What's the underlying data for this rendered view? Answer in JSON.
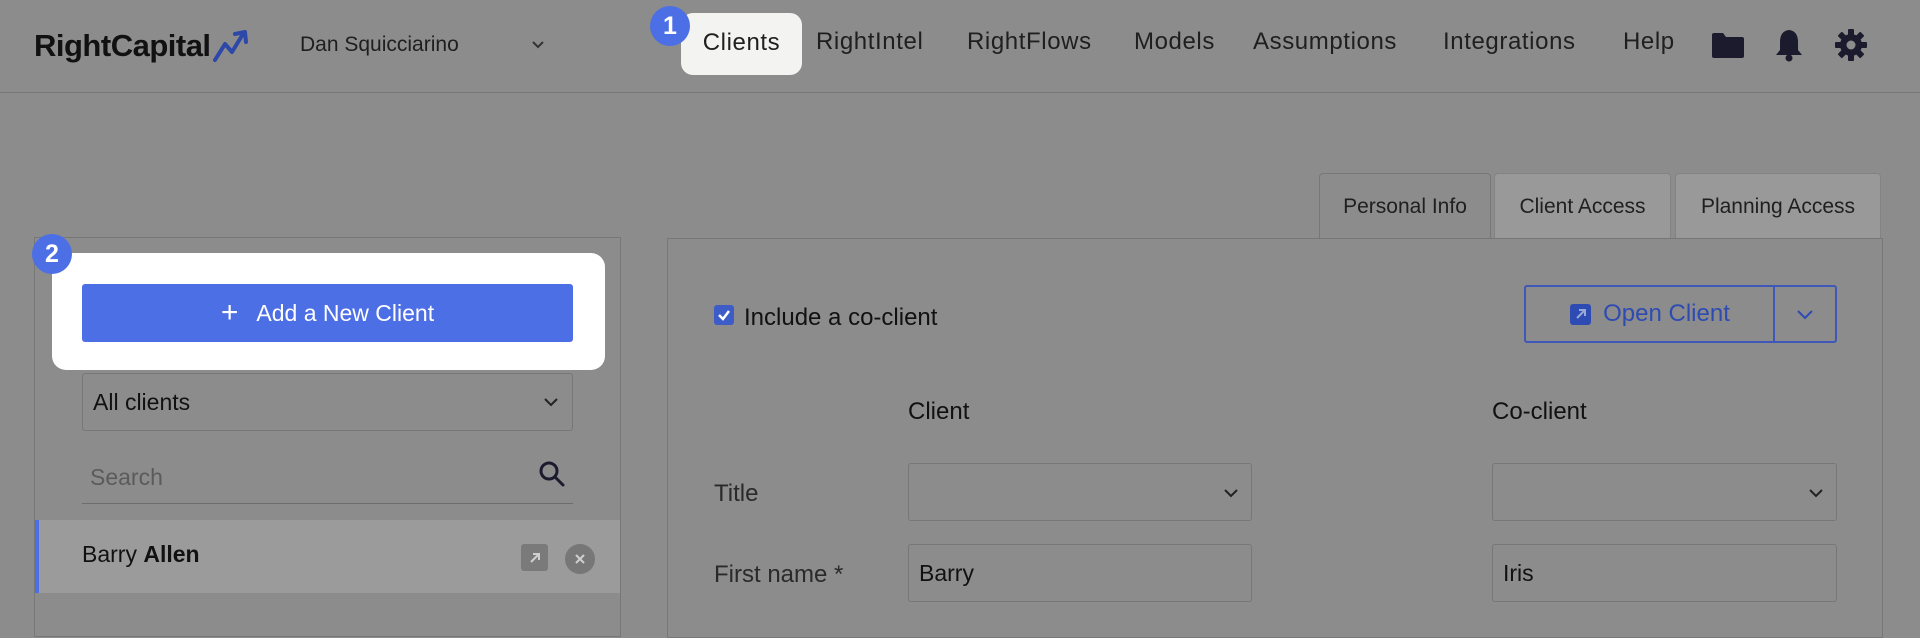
{
  "header": {
    "logo_text": "RightCapital",
    "advisor_name": "Dan Squicciarino",
    "nav": [
      {
        "label": "Clients"
      },
      {
        "label": "RightIntel"
      },
      {
        "label": "RightFlows"
      },
      {
        "label": "Models"
      },
      {
        "label": "Assumptions"
      },
      {
        "label": "Integrations"
      },
      {
        "label": "Help"
      }
    ],
    "icons": [
      "folder-icon",
      "bell-icon",
      "gear-icon"
    ]
  },
  "steps": {
    "one": "1",
    "two": "2"
  },
  "tabs": [
    {
      "label": "Personal Info",
      "active": true
    },
    {
      "label": "Client Access",
      "active": false
    },
    {
      "label": "Planning Access",
      "active": false
    }
  ],
  "sidebar": {
    "add_button_label": "Add a New Client",
    "filter_value": "All clients",
    "search_placeholder": "Search",
    "clients": [
      {
        "first": "Barry",
        "last": "Allen"
      }
    ]
  },
  "form": {
    "include_coclient_label": "Include a co-client",
    "include_coclient_checked": true,
    "open_client_label": "Open Client",
    "col_client": "Client",
    "col_coclient": "Co-client",
    "rows": [
      {
        "label": "Title",
        "client": "",
        "coclient": ""
      },
      {
        "label": "First name *",
        "client": "Barry",
        "coclient": "Iris"
      }
    ]
  },
  "colors": {
    "accent": "#4c6fe6",
    "overlay": "#8c8c8c",
    "link": "#2e4bb3"
  }
}
